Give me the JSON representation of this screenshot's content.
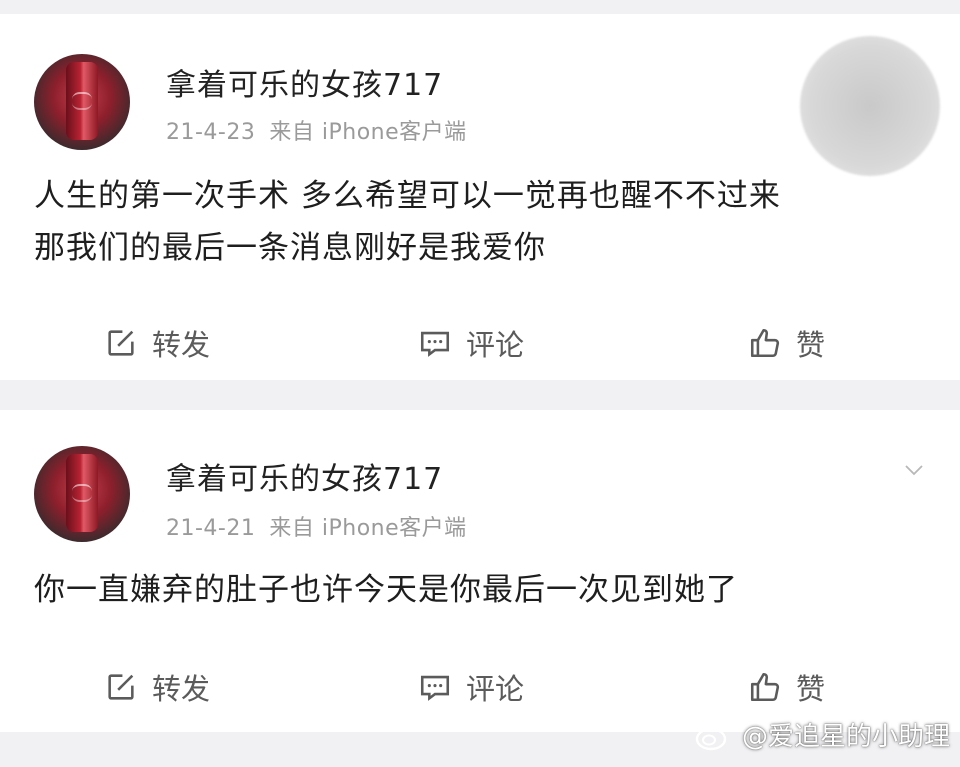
{
  "posts": [
    {
      "username": "拿着可乐的女孩717",
      "date": "21-4-23",
      "source": "来自 iPhone客户端",
      "content_lines": [
        "人生的第一次手术 多么希望可以一觉再也醒不不过来",
        "那我们的最后一条消息刚好是我爱你"
      ],
      "actions": {
        "repost": "转发",
        "comment": "评论",
        "like": "赞"
      }
    },
    {
      "username": "拿着可乐的女孩717",
      "date": "21-4-21",
      "source": "来自 iPhone客户端",
      "content_lines": [
        "你一直嫌弃的肚子也许今天是你最后一次见到她了"
      ],
      "actions": {
        "repost": "转发",
        "comment": "评论",
        "like": "赞"
      }
    }
  ],
  "watermark": "@爱追星的小助理",
  "icons": {
    "repost": "edit-square-icon",
    "comment": "comment-bubble-icon",
    "like": "thumbs-up-icon",
    "menu": "chevron-down-icon",
    "watermark": "weibo-logo-icon"
  },
  "colors": {
    "text": "#1e1e1e",
    "meta": "#9a9a9a",
    "action": "#5b5b5b",
    "divider": "#f1f1f3"
  }
}
